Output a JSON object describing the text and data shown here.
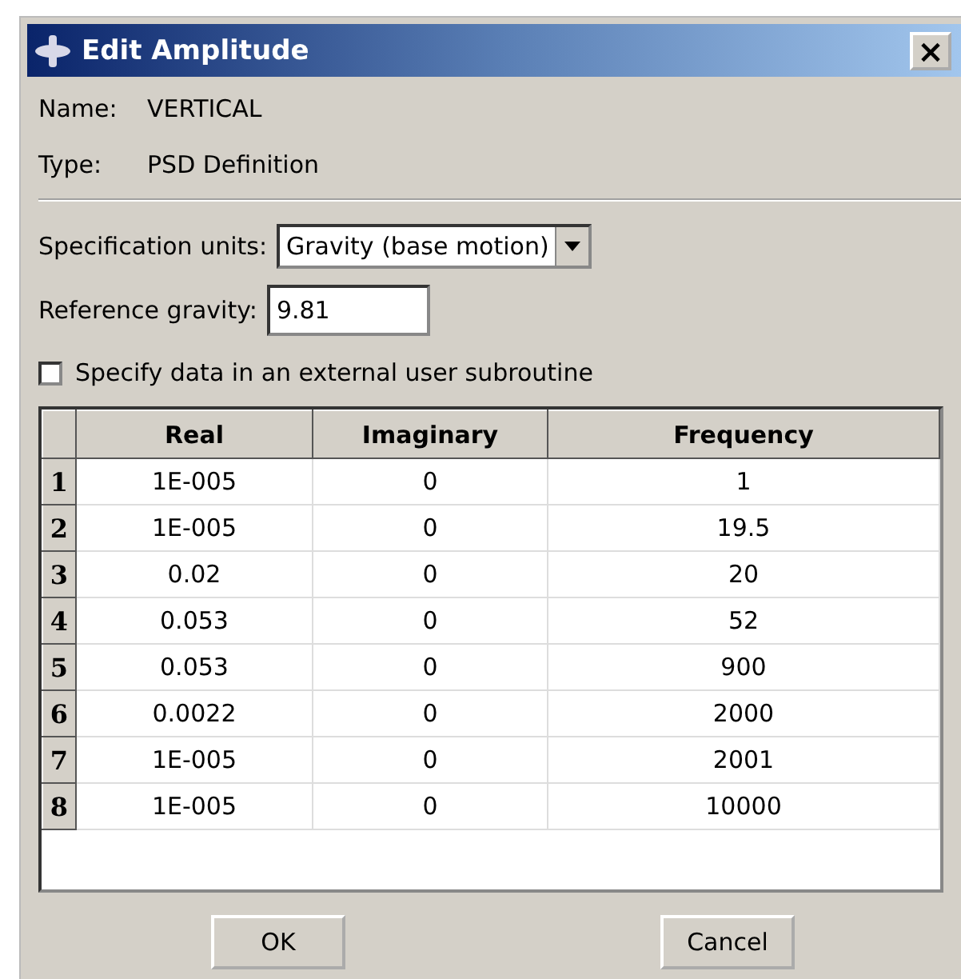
{
  "window": {
    "title": "Edit Amplitude",
    "close": "×"
  },
  "name": {
    "label": "Name:",
    "value": "VERTICAL"
  },
  "type": {
    "label": "Type:",
    "value": "PSD Definition"
  },
  "specification_units": {
    "label": "Specification units:",
    "value": "Gravity (base motion)"
  },
  "reference_gravity": {
    "label": "Reference gravity:",
    "value": "9.81"
  },
  "user_subroutine": {
    "label": "Specify data in an external user subroutine",
    "checked": false
  },
  "table": {
    "columns": [
      "Real",
      "Imaginary",
      "Frequency"
    ],
    "rows": [
      {
        "index": "1",
        "cells": [
          "1E-005",
          "0",
          "1"
        ]
      },
      {
        "index": "2",
        "cells": [
          "1E-005",
          "0",
          "19.5"
        ]
      },
      {
        "index": "3",
        "cells": [
          "0.02",
          "0",
          "20"
        ]
      },
      {
        "index": "4",
        "cells": [
          "0.053",
          "0",
          "52"
        ]
      },
      {
        "index": "5",
        "cells": [
          "0.053",
          "0",
          "900"
        ]
      },
      {
        "index": "6",
        "cells": [
          "0.0022",
          "0",
          "2000"
        ]
      },
      {
        "index": "7",
        "cells": [
          "1E-005",
          "0",
          "2001"
        ]
      },
      {
        "index": "8",
        "cells": [
          "1E-005",
          "0",
          "10000"
        ]
      }
    ]
  },
  "buttons": [
    "OK",
    "Cancel"
  ]
}
